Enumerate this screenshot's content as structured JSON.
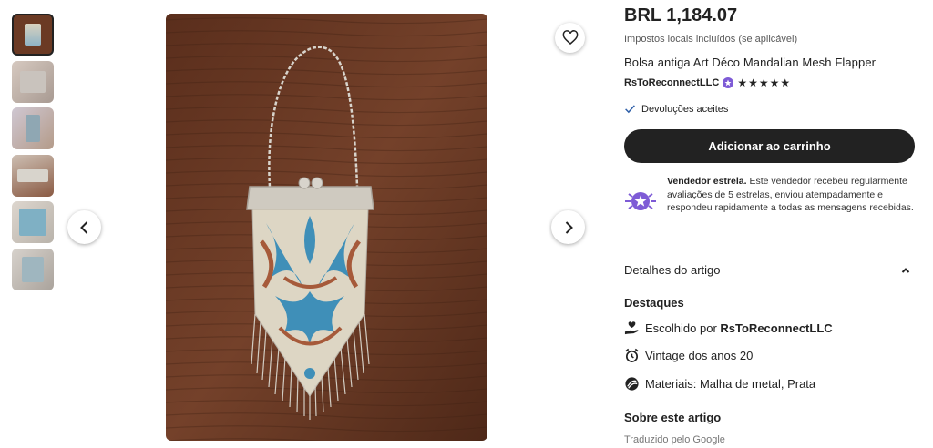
{
  "gallery": {
    "thumbnail_count": 6,
    "active_index": 0,
    "prev_label": "Imagem anterior",
    "next_label": "Próxima imagem",
    "favorite_label": "Adicionar aos favoritos"
  },
  "listing": {
    "price": "BRL 1,184.07",
    "tax_note": "Impostos locais incluídos (se aplicável)",
    "title": "Bolsa antiga Art Déco Mandalian Mesh Flapper",
    "seller": "RsToReconnectLLC",
    "rating_stars": "★★★★★",
    "rating": 5,
    "returns": "Devoluções aceites",
    "add_to_cart": "Adicionar ao carrinho"
  },
  "star_seller": {
    "label": "Vendedor estrela.",
    "description": " Este vendedor recebeu regularmente avaliações de 5 estrelas, enviou atempadamente e respondeu rapidamente a todas as mensagens recebidas."
  },
  "details": {
    "section_title": "Detalhes do artigo",
    "highlights_title": "Destaques",
    "chosen_by_prefix": "Escolhido por ",
    "chosen_by_name": "RsToReconnectLLC",
    "vintage": "Vintage dos anos 20",
    "materials": "Materiais: Malha de metal, Prata",
    "about_title": "Sobre este artigo",
    "translated_by": "Traduzido pelo Google"
  },
  "colors": {
    "primary": "#222222",
    "star_seller_purple": "#7e5bd6",
    "wood": "#6b3a24",
    "check": "#2e5fa8"
  },
  "icons": {
    "heart": "heart-icon",
    "chevron_left": "chevron-left-icon",
    "chevron_right": "chevron-right-icon",
    "check": "check-icon",
    "star_seller": "star-seller-badge-icon",
    "chevron_up": "chevron-up-icon",
    "hand": "hand-heart-icon",
    "clock": "alarm-clock-icon",
    "materials": "materials-icon"
  }
}
